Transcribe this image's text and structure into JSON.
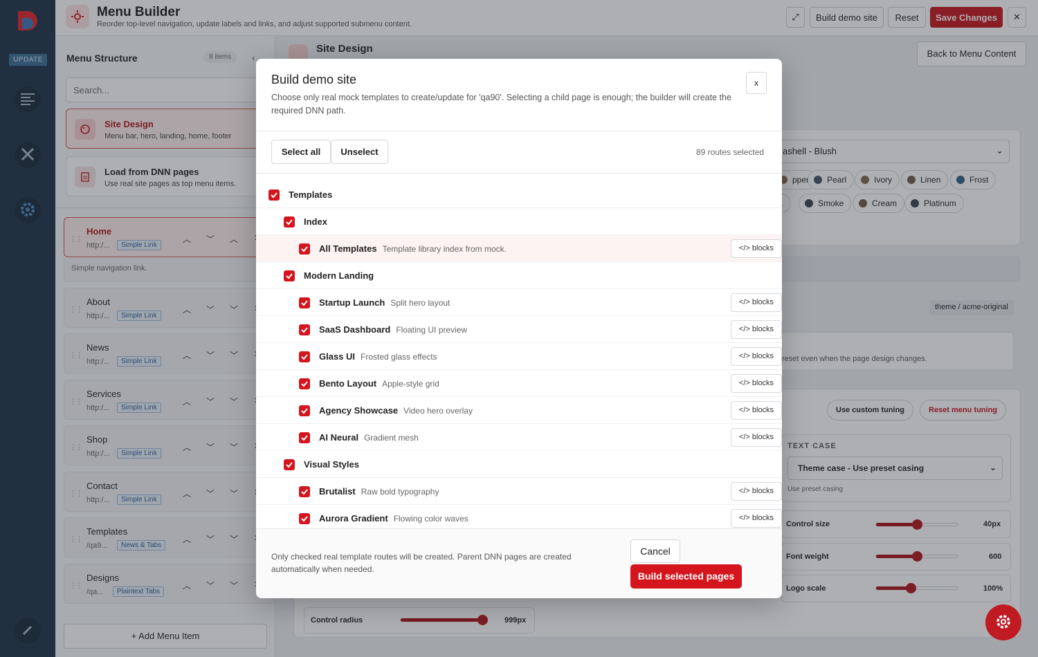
{
  "rail": {
    "logo_text": "DNN",
    "update_label": "UPDATE"
  },
  "header": {
    "title": "Menu Builder",
    "subtitle": "Reorder top-level navigation, update labels and links, and adjust supported submenu content.",
    "build_demo_label": "Build demo site",
    "reset_label": "Reset",
    "save_label": "Save Changes",
    "close_label": "✕"
  },
  "sidebar": {
    "title": "Menu Structure",
    "count": "8 items",
    "search_placeholder": "Search...",
    "site_design": {
      "title": "Site Design",
      "subtitle": "Menu bar, hero, landing, home, footer"
    },
    "load_pages": {
      "title": "Load from DNN pages",
      "subtitle": "Use real site pages as top menu items."
    },
    "items": [
      {
        "title": "Home",
        "url": "http:/...",
        "badge": "Simple Link"
      },
      {
        "title": "About",
        "url": "http:/...",
        "badge": "Simple Link"
      },
      {
        "title": "News",
        "url": "http:/...",
        "badge": "Simple Link"
      },
      {
        "title": "Services",
        "url": "http:/...",
        "badge": "Simple Link"
      },
      {
        "title": "Shop",
        "url": "http:/...",
        "badge": "Simple Link"
      },
      {
        "title": "Contact",
        "url": "http:/...",
        "badge": "Simple Link"
      },
      {
        "title": "Templates",
        "url": "/qa9...",
        "badge": "News & Tabs"
      },
      {
        "title": "Designs",
        "url": "/qa...",
        "badge": "Plaintext Tabs"
      }
    ],
    "selected_hint": "Simple navigation link.",
    "add_label": "+ Add Menu Item"
  },
  "main": {
    "title": "Site Design",
    "back_label": "Back to Menu Content",
    "preset_value": "ashell - Blush",
    "chips_row1": [
      {
        "label": "pper",
        "color": "#8a6a55"
      },
      {
        "label": "Pearl",
        "color": "#4a5560"
      },
      {
        "label": "Ivory",
        "color": "#7a6a4a"
      },
      {
        "label": "Linen",
        "color": "#6e5c4c"
      },
      {
        "label": "Frost",
        "color": "#2e5f85"
      }
    ],
    "chips_row2": [
      {
        "label": "k",
        "color": ""
      },
      {
        "label": "Smoke",
        "color": "#3a4452"
      },
      {
        "label": "Cream",
        "color": "#6e5a40"
      },
      {
        "label": "Platinum",
        "color": "#3b4250"
      }
    ],
    "theme_tag": "theme / acme-original",
    "preset_note": "reset even when the page design changes.",
    "custom_tuning_label": "Use custom tuning",
    "reset_tuning_label": "Reset menu tuning",
    "text_case_label": "TEXT CASE",
    "text_case_value": "Theme case - Use preset casing",
    "text_case_hint": "Use preset casing",
    "control_size": {
      "label": "Control size",
      "value": "40px",
      "fill": 0.5
    },
    "font_weight": {
      "label": "Font weight",
      "value": "600",
      "fill": 0.5
    },
    "logo_scale": {
      "label": "Logo scale",
      "value": "100%",
      "fill": 0.42
    },
    "control_radius": {
      "label": "Control radius",
      "value": "999px",
      "fill": 1.0
    }
  },
  "modal": {
    "title": "Build demo site",
    "description": "Choose only real mock templates to create/update for 'qa90'. Selecting a child page is enough; the builder will create the required DNN path.",
    "close_label": "x",
    "select_all_label": "Select all",
    "unselect_label": "Unselect",
    "selected_count": "89 routes selected",
    "blocks_label": "</> blocks",
    "rows": [
      {
        "label": "Templates",
        "desc": "",
        "level": 0,
        "blocks": false
      },
      {
        "label": "Index",
        "desc": "",
        "level": 1,
        "blocks": false
      },
      {
        "label": "All Templates",
        "desc": "Template library index from mock.",
        "level": 2,
        "blocks": true
      },
      {
        "label": "Modern Landing",
        "desc": "",
        "level": 1,
        "blocks": false
      },
      {
        "label": "Startup Launch",
        "desc": "Split hero layout",
        "level": 2,
        "blocks": true
      },
      {
        "label": "SaaS Dashboard",
        "desc": "Floating UI preview",
        "level": 2,
        "blocks": true
      },
      {
        "label": "Glass UI",
        "desc": "Frosted glass effects",
        "level": 2,
        "blocks": true
      },
      {
        "label": "Bento Layout",
        "desc": "Apple-style grid",
        "level": 2,
        "blocks": true
      },
      {
        "label": "Agency Showcase",
        "desc": "Video hero overlay",
        "level": 2,
        "blocks": true
      },
      {
        "label": "AI Neural",
        "desc": "Gradient mesh",
        "level": 2,
        "blocks": true
      },
      {
        "label": "Visual Styles",
        "desc": "",
        "level": 1,
        "blocks": false
      },
      {
        "label": "Brutalist",
        "desc": "Raw bold typography",
        "level": 2,
        "blocks": true
      },
      {
        "label": "Aurora Gradient",
        "desc": "Flowing color waves",
        "level": 2,
        "blocks": true
      }
    ],
    "footer_note": "Only checked real template routes will be created. Parent DNN pages are created automatically when needed.",
    "cancel_label": "Cancel",
    "build_label": "Build selected pages"
  },
  "colors": {
    "accent": "#d4151d",
    "rail": "#1e3348"
  }
}
